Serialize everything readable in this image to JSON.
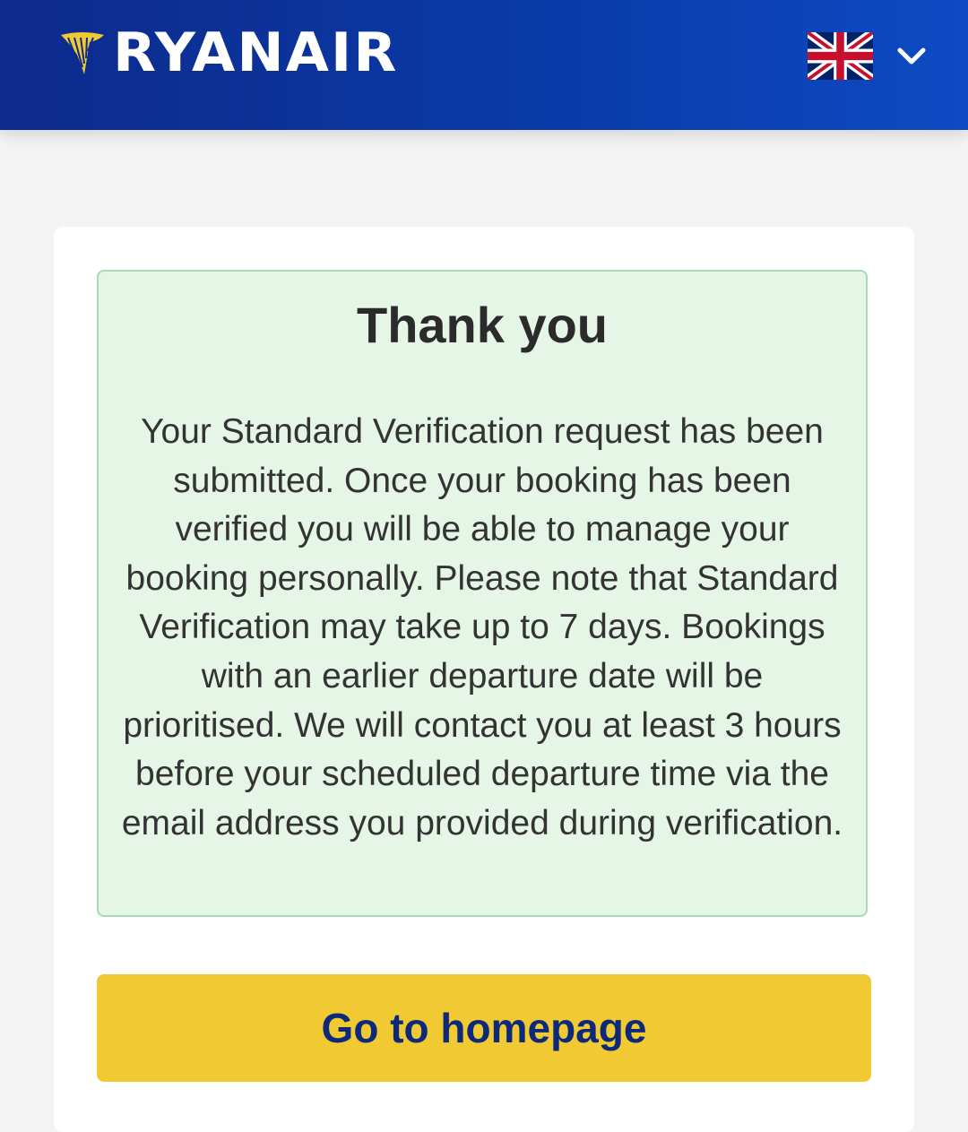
{
  "header": {
    "brand": "RYANAIR",
    "language": {
      "flag_icon": "uk-flag-icon",
      "dropdown_icon": "chevron-down-icon"
    },
    "colors": {
      "background": "#0a3aa6",
      "logo_harp": "#f1c933"
    }
  },
  "notice": {
    "title": "Thank you",
    "body": "Your Standard Verification request has been submitted. Once your booking has been verified you will be able to manage your booking personally. Please note that Standard Verification may take up to 7 days. Bookings with an earlier departure date will be prioritised. We will contact you at least 3 hours before your scheduled departure time via the email address you provided during verification.",
    "colors": {
      "background": "#e6f6e6",
      "border": "#a9dbb0"
    }
  },
  "actions": {
    "home_button_label": "Go to homepage",
    "colors": {
      "button_background": "#f1c933",
      "button_text": "#0d2a7a"
    }
  }
}
